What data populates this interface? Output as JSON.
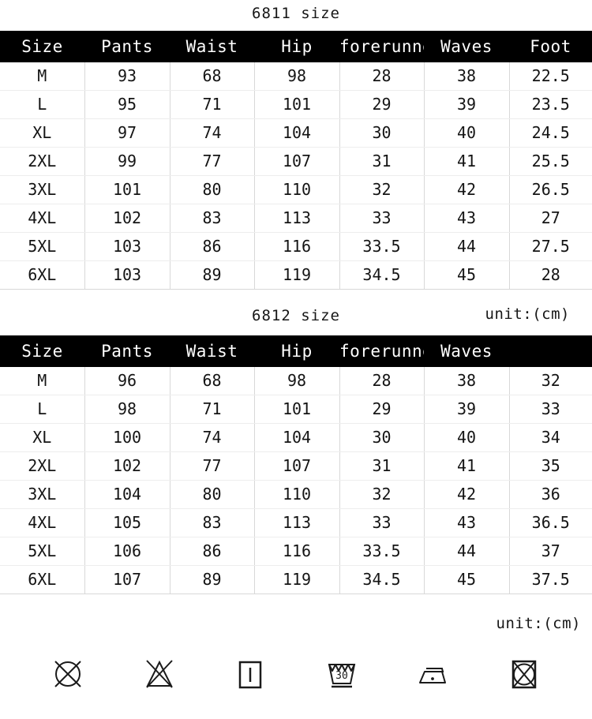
{
  "tables": [
    {
      "title": "6811 size",
      "columns": [
        "Size",
        "Pants",
        "Waist",
        "Hip",
        "forerunner",
        "Waves",
        "Foot"
      ],
      "rows": [
        [
          "M",
          "93",
          "68",
          "98",
          "28",
          "38",
          "22.5"
        ],
        [
          "L",
          "95",
          "71",
          "101",
          "29",
          "39",
          "23.5"
        ],
        [
          "XL",
          "97",
          "74",
          "104",
          "30",
          "40",
          "24.5"
        ],
        [
          "2XL",
          "99",
          "77",
          "107",
          "31",
          "41",
          "25.5"
        ],
        [
          "3XL",
          "101",
          "80",
          "110",
          "32",
          "42",
          "26.5"
        ],
        [
          "4XL",
          "102",
          "83",
          "113",
          "33",
          "43",
          "27"
        ],
        [
          "5XL",
          "103",
          "86",
          "116",
          "33.5",
          "44",
          "27.5"
        ],
        [
          "6XL",
          "103",
          "89",
          "119",
          "34.5",
          "45",
          "28"
        ]
      ],
      "unit": "unit:(cm)"
    },
    {
      "title": "6812 size",
      "columns": [
        "Size",
        "Pants",
        "Waist",
        "Hip",
        "forerunner",
        "Waves",
        ""
      ],
      "rows": [
        [
          "M",
          "96",
          "68",
          "98",
          "28",
          "38",
          "32"
        ],
        [
          "L",
          "98",
          "71",
          "101",
          "29",
          "39",
          "33"
        ],
        [
          "XL",
          "100",
          "74",
          "104",
          "30",
          "40",
          "34"
        ],
        [
          "2XL",
          "102",
          "77",
          "107",
          "31",
          "41",
          "35"
        ],
        [
          "3XL",
          "104",
          "80",
          "110",
          "32",
          "42",
          "36"
        ],
        [
          "4XL",
          "105",
          "83",
          "113",
          "33",
          "43",
          "36.5"
        ],
        [
          "5XL",
          "106",
          "86",
          "116",
          "33.5",
          "44",
          "37"
        ],
        [
          "6XL",
          "107",
          "89",
          "119",
          "34.5",
          "45",
          "37.5"
        ]
      ],
      "unit": "unit:(cm)"
    }
  ],
  "care_symbols": [
    {
      "name": "do-not-dry-clean-icon",
      "label": "do not dry clean"
    },
    {
      "name": "do-not-bleach-icon",
      "label": "do not bleach"
    },
    {
      "name": "drip-dry-in-shade-icon",
      "label": "drip dry in shade"
    },
    {
      "name": "machine-wash-30-icon",
      "label": "machine wash 30",
      "value": "30"
    },
    {
      "name": "iron-low-heat-icon",
      "label": "iron low heat"
    },
    {
      "name": "do-not-tumble-dry-icon",
      "label": "do not tumble dry"
    }
  ],
  "colors": {
    "header_background": "#000000",
    "header_text": "#ffffff",
    "body_text": "#141414",
    "grid_line": "#d8d8d8",
    "page_background": "#ffffff"
  }
}
